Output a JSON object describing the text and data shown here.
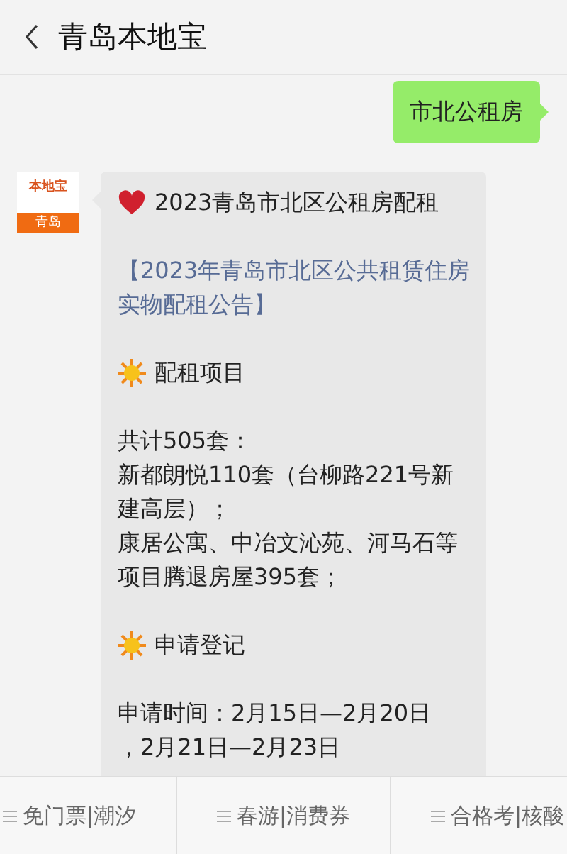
{
  "header": {
    "title": "青岛本地宝"
  },
  "messages": [
    {
      "kind": "outgoing",
      "text": "市北公租房"
    },
    {
      "kind": "incoming",
      "avatar": {
        "brand": "本地宝",
        "city": "青岛"
      },
      "blocks": [
        {
          "kind": "heart_heading",
          "text": "2023青岛市北区公租房配租"
        },
        {
          "kind": "link",
          "text": "【2023年青岛市北区公共租赁住房实物配租公告】"
        },
        {
          "kind": "sun_heading",
          "text": "配租项目"
        },
        {
          "kind": "lines",
          "lines": [
            "共计505套：",
            "新都朗悦110套（台柳路221号新建高层）；",
            "康居公寓、中冶文沁苑、河马石等项目腾退房屋395套；"
          ]
        },
        {
          "kind": "sun_heading",
          "text": "申请登记"
        },
        {
          "kind": "lines",
          "lines": [
            "申请时间：2月15日—2月20日",
            "，2月21日—2月23日"
          ]
        }
      ]
    }
  ],
  "menu": [
    {
      "label": "免门票|潮汐"
    },
    {
      "label": "春游|消费券"
    },
    {
      "label": "合格考|核酸"
    }
  ]
}
